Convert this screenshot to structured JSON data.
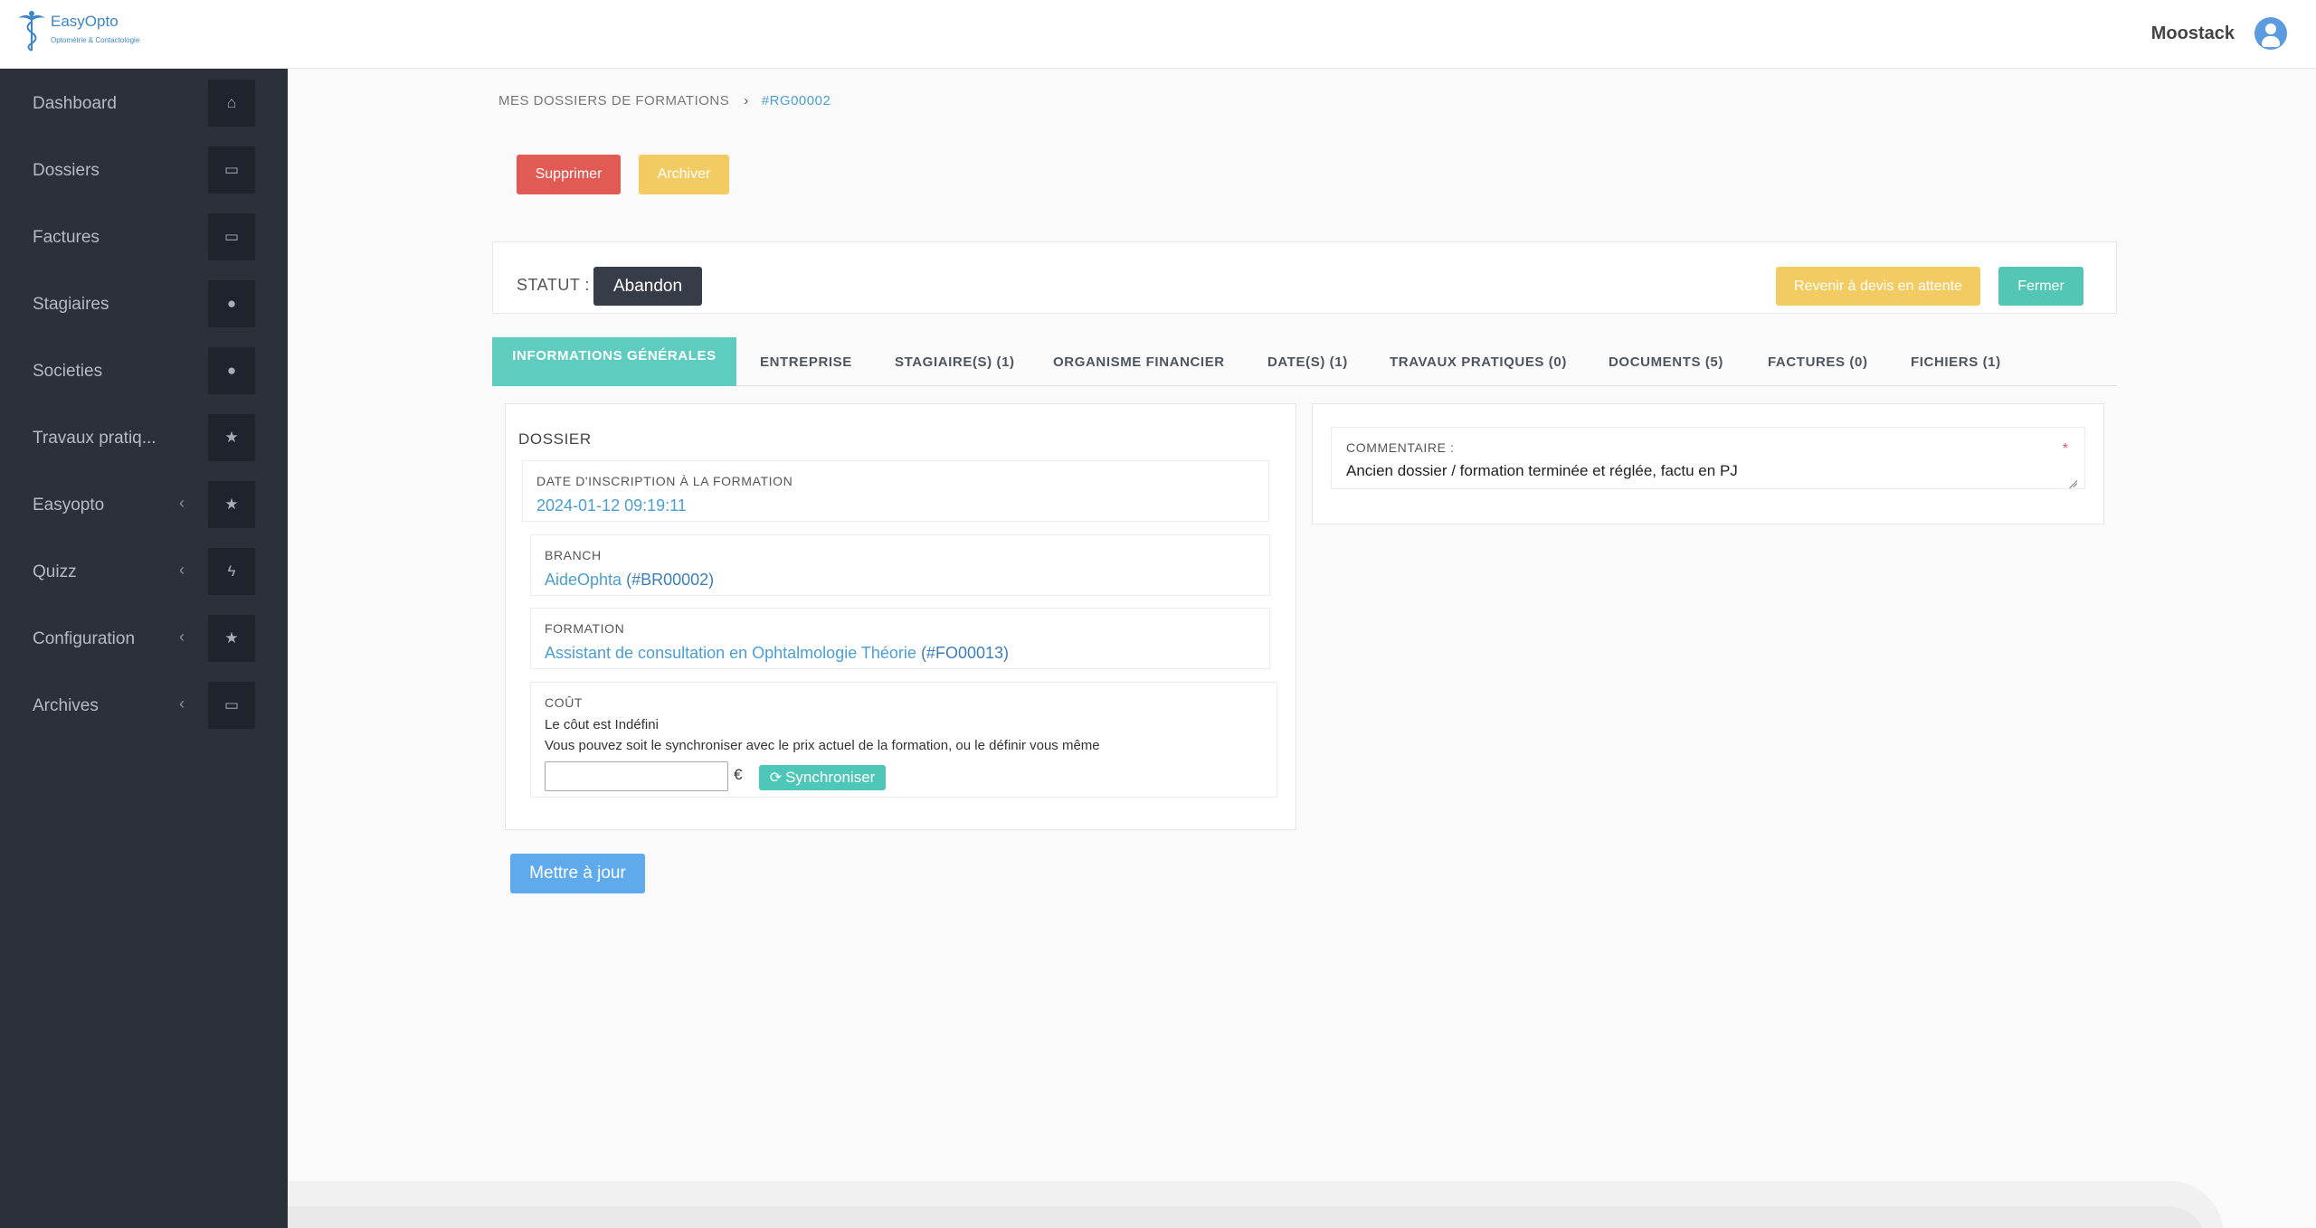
{
  "header": {
    "logo_text": "EasyOpto",
    "logo_subtitle": "Optométrie & Contactologie",
    "user_name": "Moostack"
  },
  "sidebar": {
    "items": [
      {
        "label": "Dashboard",
        "icon": "home-icon",
        "glyph": "⌂",
        "has_chevron": false
      },
      {
        "label": "Dossiers",
        "icon": "card-icon",
        "glyph": "▭",
        "has_chevron": false
      },
      {
        "label": "Factures",
        "icon": "card-icon",
        "glyph": "▭",
        "has_chevron": false
      },
      {
        "label": "Stagiaires",
        "icon": "user-icon",
        "glyph": "●",
        "has_chevron": false
      },
      {
        "label": "Societies",
        "icon": "user-icon",
        "glyph": "●",
        "has_chevron": false
      },
      {
        "label": "Travaux pratiq...",
        "icon": "star-icon",
        "glyph": "★",
        "has_chevron": false
      },
      {
        "label": "Easyopto",
        "icon": "star-icon",
        "glyph": "★",
        "has_chevron": true
      },
      {
        "label": "Quizz",
        "icon": "bolt-icon",
        "glyph": "ϟ",
        "has_chevron": true
      },
      {
        "label": "Configuration",
        "icon": "star-icon",
        "glyph": "★",
        "has_chevron": true
      },
      {
        "label": "Archives",
        "icon": "card-icon",
        "glyph": "▭",
        "has_chevron": true
      }
    ]
  },
  "breadcrumb": {
    "parent": "MES DOSSIERS DE FORMATIONS",
    "separator": "›",
    "current": "#RG00002"
  },
  "actions": {
    "delete_label": "Supprimer",
    "archive_label": "Archiver"
  },
  "status": {
    "label": "STATUT :",
    "value": "Abandon",
    "revert_label": "Revenir à devis en attente",
    "close_label": "Fermer"
  },
  "tabs": [
    {
      "label": "INFORMATIONS GÉNÉRALES",
      "active": true
    },
    {
      "label": "ENTREPRISE",
      "active": false
    },
    {
      "label": "STAGIAIRE(S) (1)",
      "active": false
    },
    {
      "label": "ORGANISME FINANCIER",
      "active": false
    },
    {
      "label": "DATE(S) (1)",
      "active": false
    },
    {
      "label": "TRAVAUX PRATIQUES (0)",
      "active": false
    },
    {
      "label": "DOCUMENTS (5)",
      "active": false
    },
    {
      "label": "FACTURES (0)",
      "active": false
    },
    {
      "label": "FICHIERS (1)",
      "active": false
    }
  ],
  "dossier": {
    "title": "DOSSIER",
    "inscription_label": "DATE D'INSCRIPTION À LA FORMATION",
    "inscription_value": "2024-01-12 09:19:11",
    "branch_label": "BRANCH",
    "branch_name": "AideOphta",
    "branch_code": "(#BR00002)",
    "formation_label": "FORMATION",
    "formation_name": "Assistant de consultation en Ophtalmologie Théorie",
    "formation_code": "(#FO00013)",
    "cost_label": "COÛT",
    "cost_line1": "Le côut est Indéfini",
    "cost_line2": "Vous pouvez soit le synchroniser avec le prix actuel de la formation, ou le définir vous même",
    "cost_value": "",
    "currency": "€",
    "sync_label": "Synchroniser"
  },
  "update_label": "Mettre à jour",
  "comment": {
    "label": "COMMENTAIRE :",
    "required_mark": "*",
    "value": "Ancien dossier / formation terminée et réglée, factu en PJ"
  },
  "colors": {
    "sidebar_bg": "#2b303b",
    "accent_teal": "#5ecdbf",
    "danger": "#e25a54",
    "warning": "#f2cb63",
    "primary": "#5eaaec",
    "link": "#4a9fd1"
  }
}
